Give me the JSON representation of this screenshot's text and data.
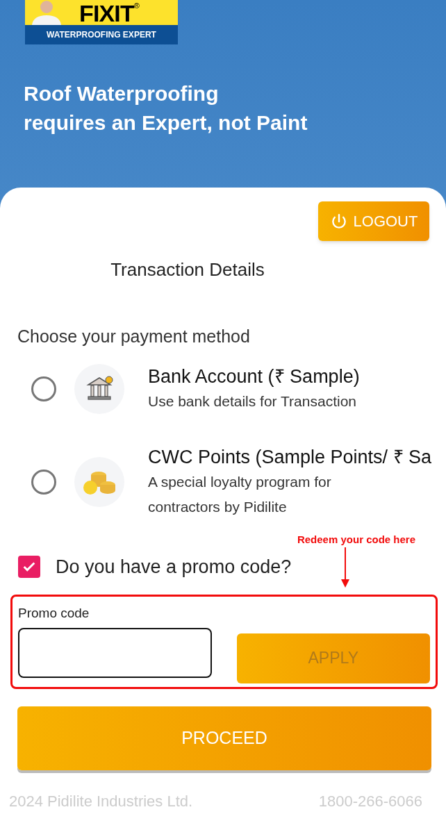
{
  "logo": {
    "brand": "FIXIT",
    "mark": "®",
    "tagline": "WATERPROOFING EXPERT"
  },
  "hero": {
    "headline_lines": [
      "Roof Waterproofing",
      "requires an Expert, not Paint"
    ]
  },
  "logout_button": {
    "label": "LOGOUT"
  },
  "title": "Transaction Details",
  "payment": {
    "heading": "Choose your payment method",
    "options": [
      {
        "kind": "bank",
        "title": "Bank Account (₹ Sample)",
        "description": "Use bank details for Transaction",
        "selected": false
      },
      {
        "kind": "coins",
        "title": "CWC Points (Sample Points/ ₹ Sa",
        "description": "A special loyalty program for contractors by Pidilite",
        "selected": false
      }
    ]
  },
  "promo_toggle": {
    "label": "Do you have a promo code?",
    "checked": true
  },
  "annotation": {
    "text": "Redeem your code here"
  },
  "promo": {
    "label": "Promo code",
    "apply": {
      "label": "APPLY",
      "disabled": true
    }
  },
  "proceed_button": {
    "label": "PROCEED"
  },
  "footer": {
    "copyright": "2024 Pidilite Industries Ltd.",
    "phone": "1800-266-6066"
  }
}
